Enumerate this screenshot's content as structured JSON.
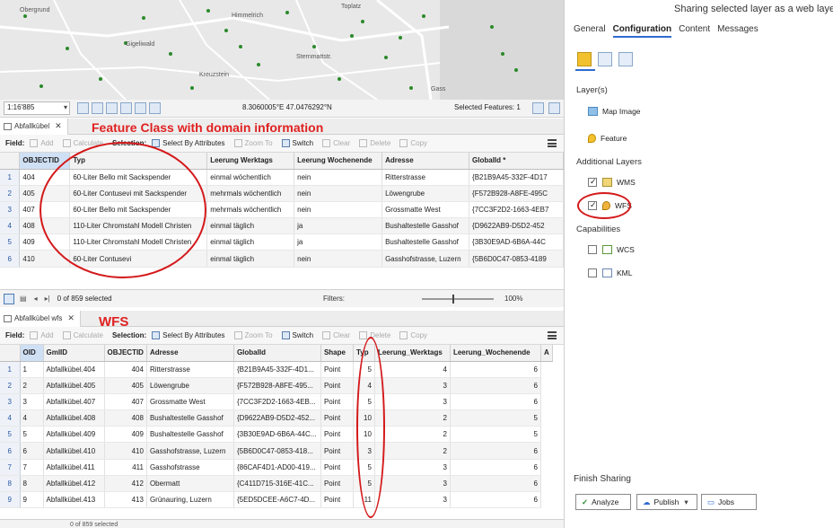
{
  "map": {
    "streets": [
      "Obergrund",
      "Himmelrich",
      "Gigeliwald",
      "Kreuzstein",
      "Sternmattstr.",
      "Gass",
      "Toplatz"
    ],
    "scale": "1:16'885",
    "coordinates": "8.3060005°E 47.0476292°N",
    "selected_features": "Selected Features: 1"
  },
  "table1": {
    "tab_label": "Abfallkübel",
    "toolbar": {
      "field": "Field:",
      "add": "Add",
      "calculate": "Calculate",
      "selection": "Selection:",
      "select_by_attributes": "Select By Attributes",
      "zoom_to": "Zoom To",
      "switch": "Switch",
      "clear": "Clear",
      "delete": "Delete",
      "copy": "Copy"
    },
    "columns": [
      "OBJECTID",
      "Typ",
      "Leerung Werktags",
      "Leerung Wochenende",
      "Adresse",
      "GlobalId *"
    ],
    "rows": [
      {
        "n": "1",
        "cells": [
          "404",
          "60-Liter Bello mit Sackspender",
          "einmal wöchentlich",
          "nein",
          "Ritterstrasse",
          "{B21B9A45-332F-4D17"
        ]
      },
      {
        "n": "2",
        "cells": [
          "405",
          "60-Liter Contusevi mit Sackspender",
          "mehrmals wöchentlich",
          "nein",
          "Löwengrube",
          "{F572B928-A8FE-495C"
        ]
      },
      {
        "n": "3",
        "cells": [
          "407",
          "60-Liter Bello mit Sackspender",
          "mehrmals wöchentlich",
          "nein",
          "Grossmatte West",
          "{7CC3F2D2-1663-4EB7"
        ]
      },
      {
        "n": "4",
        "cells": [
          "408",
          "110-Liter Chromstahl Modell Christen",
          "einmal täglich",
          "ja",
          "Bushaltestelle Gasshof",
          "{D9622AB9-D5D2-452"
        ]
      },
      {
        "n": "5",
        "cells": [
          "409",
          "110-Liter Chromstahl Modell Christen",
          "einmal täglich",
          "ja",
          "Bushaltestelle Gasshof",
          "{3B30E9AD-6B6A-44C"
        ]
      },
      {
        "n": "6",
        "cells": [
          "410",
          "60-Liter Contusevi",
          "einmal täglich",
          "nein",
          "Gasshofstrasse, Luzern",
          "{5B6D0C47-0853-4189"
        ]
      }
    ],
    "status": "0 of 859 selected",
    "filters": "Filters:",
    "zoom": "100%"
  },
  "table2": {
    "tab_label": "Abfallkübel wfs",
    "columns": [
      "OID",
      "GmlID",
      "OBJECTID",
      "Adresse",
      "GlobalId",
      "Shape",
      "Typ",
      "Leerung_Werktags",
      "Leerung_Wochenende",
      "A"
    ],
    "rows": [
      {
        "n": "1",
        "cells": [
          "1",
          "Abfallkübel.404",
          "404",
          "Ritterstrasse",
          "{B21B9A45-332F-4D1...",
          "Point",
          "5",
          "4",
          "6"
        ]
      },
      {
        "n": "2",
        "cells": [
          "2",
          "Abfallkübel.405",
          "405",
          "Löwengrube",
          "{F572B928-A8FE-495...",
          "Point",
          "4",
          "3",
          "6"
        ]
      },
      {
        "n": "3",
        "cells": [
          "3",
          "Abfallkübel.407",
          "407",
          "Grossmatte West",
          "{7CC3F2D2-1663-4EB...",
          "Point",
          "5",
          "3",
          "6"
        ]
      },
      {
        "n": "4",
        "cells": [
          "4",
          "Abfallkübel.408",
          "408",
          "Bushaltestelle Gasshof",
          "{D9622AB9-D5D2-452...",
          "Point",
          "10",
          "2",
          "5"
        ]
      },
      {
        "n": "5",
        "cells": [
          "5",
          "Abfallkübel.409",
          "409",
          "Bushaltestelle Gasshof",
          "{3B30E9AD-6B6A-44C...",
          "Point",
          "10",
          "2",
          "5"
        ]
      },
      {
        "n": "6",
        "cells": [
          "6",
          "Abfallkübel.410",
          "410",
          "Gasshofstrasse, Luzern",
          "{5B6D0C47-0853-418...",
          "Point",
          "3",
          "2",
          "6"
        ]
      },
      {
        "n": "7",
        "cells": [
          "7",
          "Abfallkübel.411",
          "411",
          "Gasshofstrasse",
          "{86CAF4D1-AD00-419...",
          "Point",
          "5",
          "3",
          "6"
        ]
      },
      {
        "n": "8",
        "cells": [
          "8",
          "Abfallkübel.412",
          "412",
          "Obermatt",
          "{C411D715-316E-41C...",
          "Point",
          "5",
          "3",
          "6"
        ]
      },
      {
        "n": "9",
        "cells": [
          "9",
          "Abfallkübel.413",
          "413",
          "Grünauring, Luzern",
          "{5ED5DCEE-A6C7-4D...",
          "Point",
          "11",
          "3",
          "6"
        ]
      }
    ],
    "status": "0 of 859 selected"
  },
  "annotations": {
    "feature_class": "Feature Class with domain information",
    "wfs": "WFS"
  },
  "panel": {
    "title": "Sharing selected layer as a web layer",
    "tabs": [
      "General",
      "Configuration",
      "Content",
      "Messages"
    ],
    "layers_heading": "Layer(s)",
    "map_image": "Map Image",
    "feature": "Feature",
    "additional_heading": "Additional Layers",
    "wms": "WMS",
    "wfs": "WFS",
    "capabilities_heading": "Capabilities",
    "wcs": "WCS",
    "kml": "KML",
    "finish_heading": "Finish Sharing",
    "analyze": "Analyze",
    "publish": "Publish",
    "jobs": "Jobs"
  },
  "colors": {
    "annotation_red": "#e02020",
    "accent_blue": "#2e6bd0"
  }
}
